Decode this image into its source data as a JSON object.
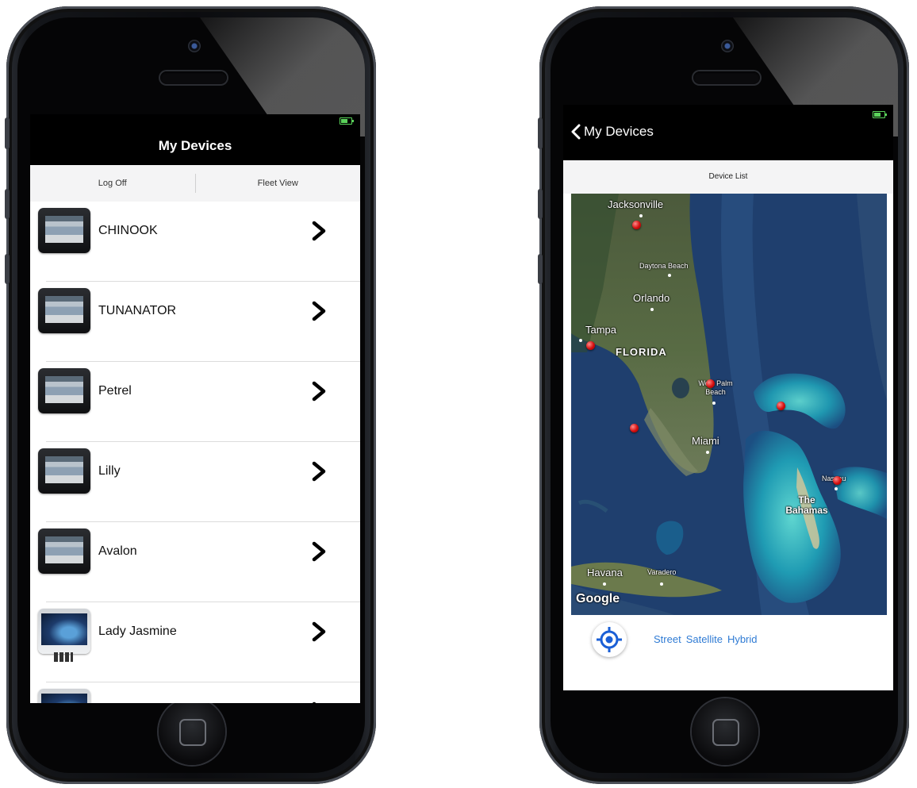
{
  "left": {
    "title": "My Devices",
    "segments": [
      "Log Off",
      "Fleet View"
    ],
    "devices": [
      {
        "name": "CHINOOK",
        "thumb": "display-unit"
      },
      {
        "name": "TUNANATOR",
        "thumb": "display-unit"
      },
      {
        "name": "Petrel",
        "thumb": "display-unit"
      },
      {
        "name": "Lilly",
        "thumb": "display-unit"
      },
      {
        "name": "Avalon",
        "thumb": "display-unit"
      },
      {
        "name": "Lady Jasmine",
        "thumb": "box-unit"
      },
      {
        "name": "",
        "thumb": "box-unit"
      }
    ]
  },
  "right": {
    "back_label": "My Devices",
    "tab_label": "Device List",
    "map": {
      "labels": {
        "jacksonville": "Jacksonville",
        "daytona": "Daytona Beach",
        "orlando": "Orlando",
        "tampa": "Tampa",
        "florida": "FLORIDA",
        "west_palm": "West Palm Beach",
        "miami": "Miami",
        "nassau": "Nassau",
        "bahamas": "The Bahamas",
        "havana": "Havana",
        "varadero": "Varadero",
        "google": "Google"
      }
    },
    "map_types": {
      "street": "Street",
      "satellite": "Satellite",
      "hybrid": "Hybrid"
    }
  },
  "colors": {
    "accent": "#2f7bd4",
    "pin": "#d40e0e",
    "status_green": "#5ad25a"
  }
}
